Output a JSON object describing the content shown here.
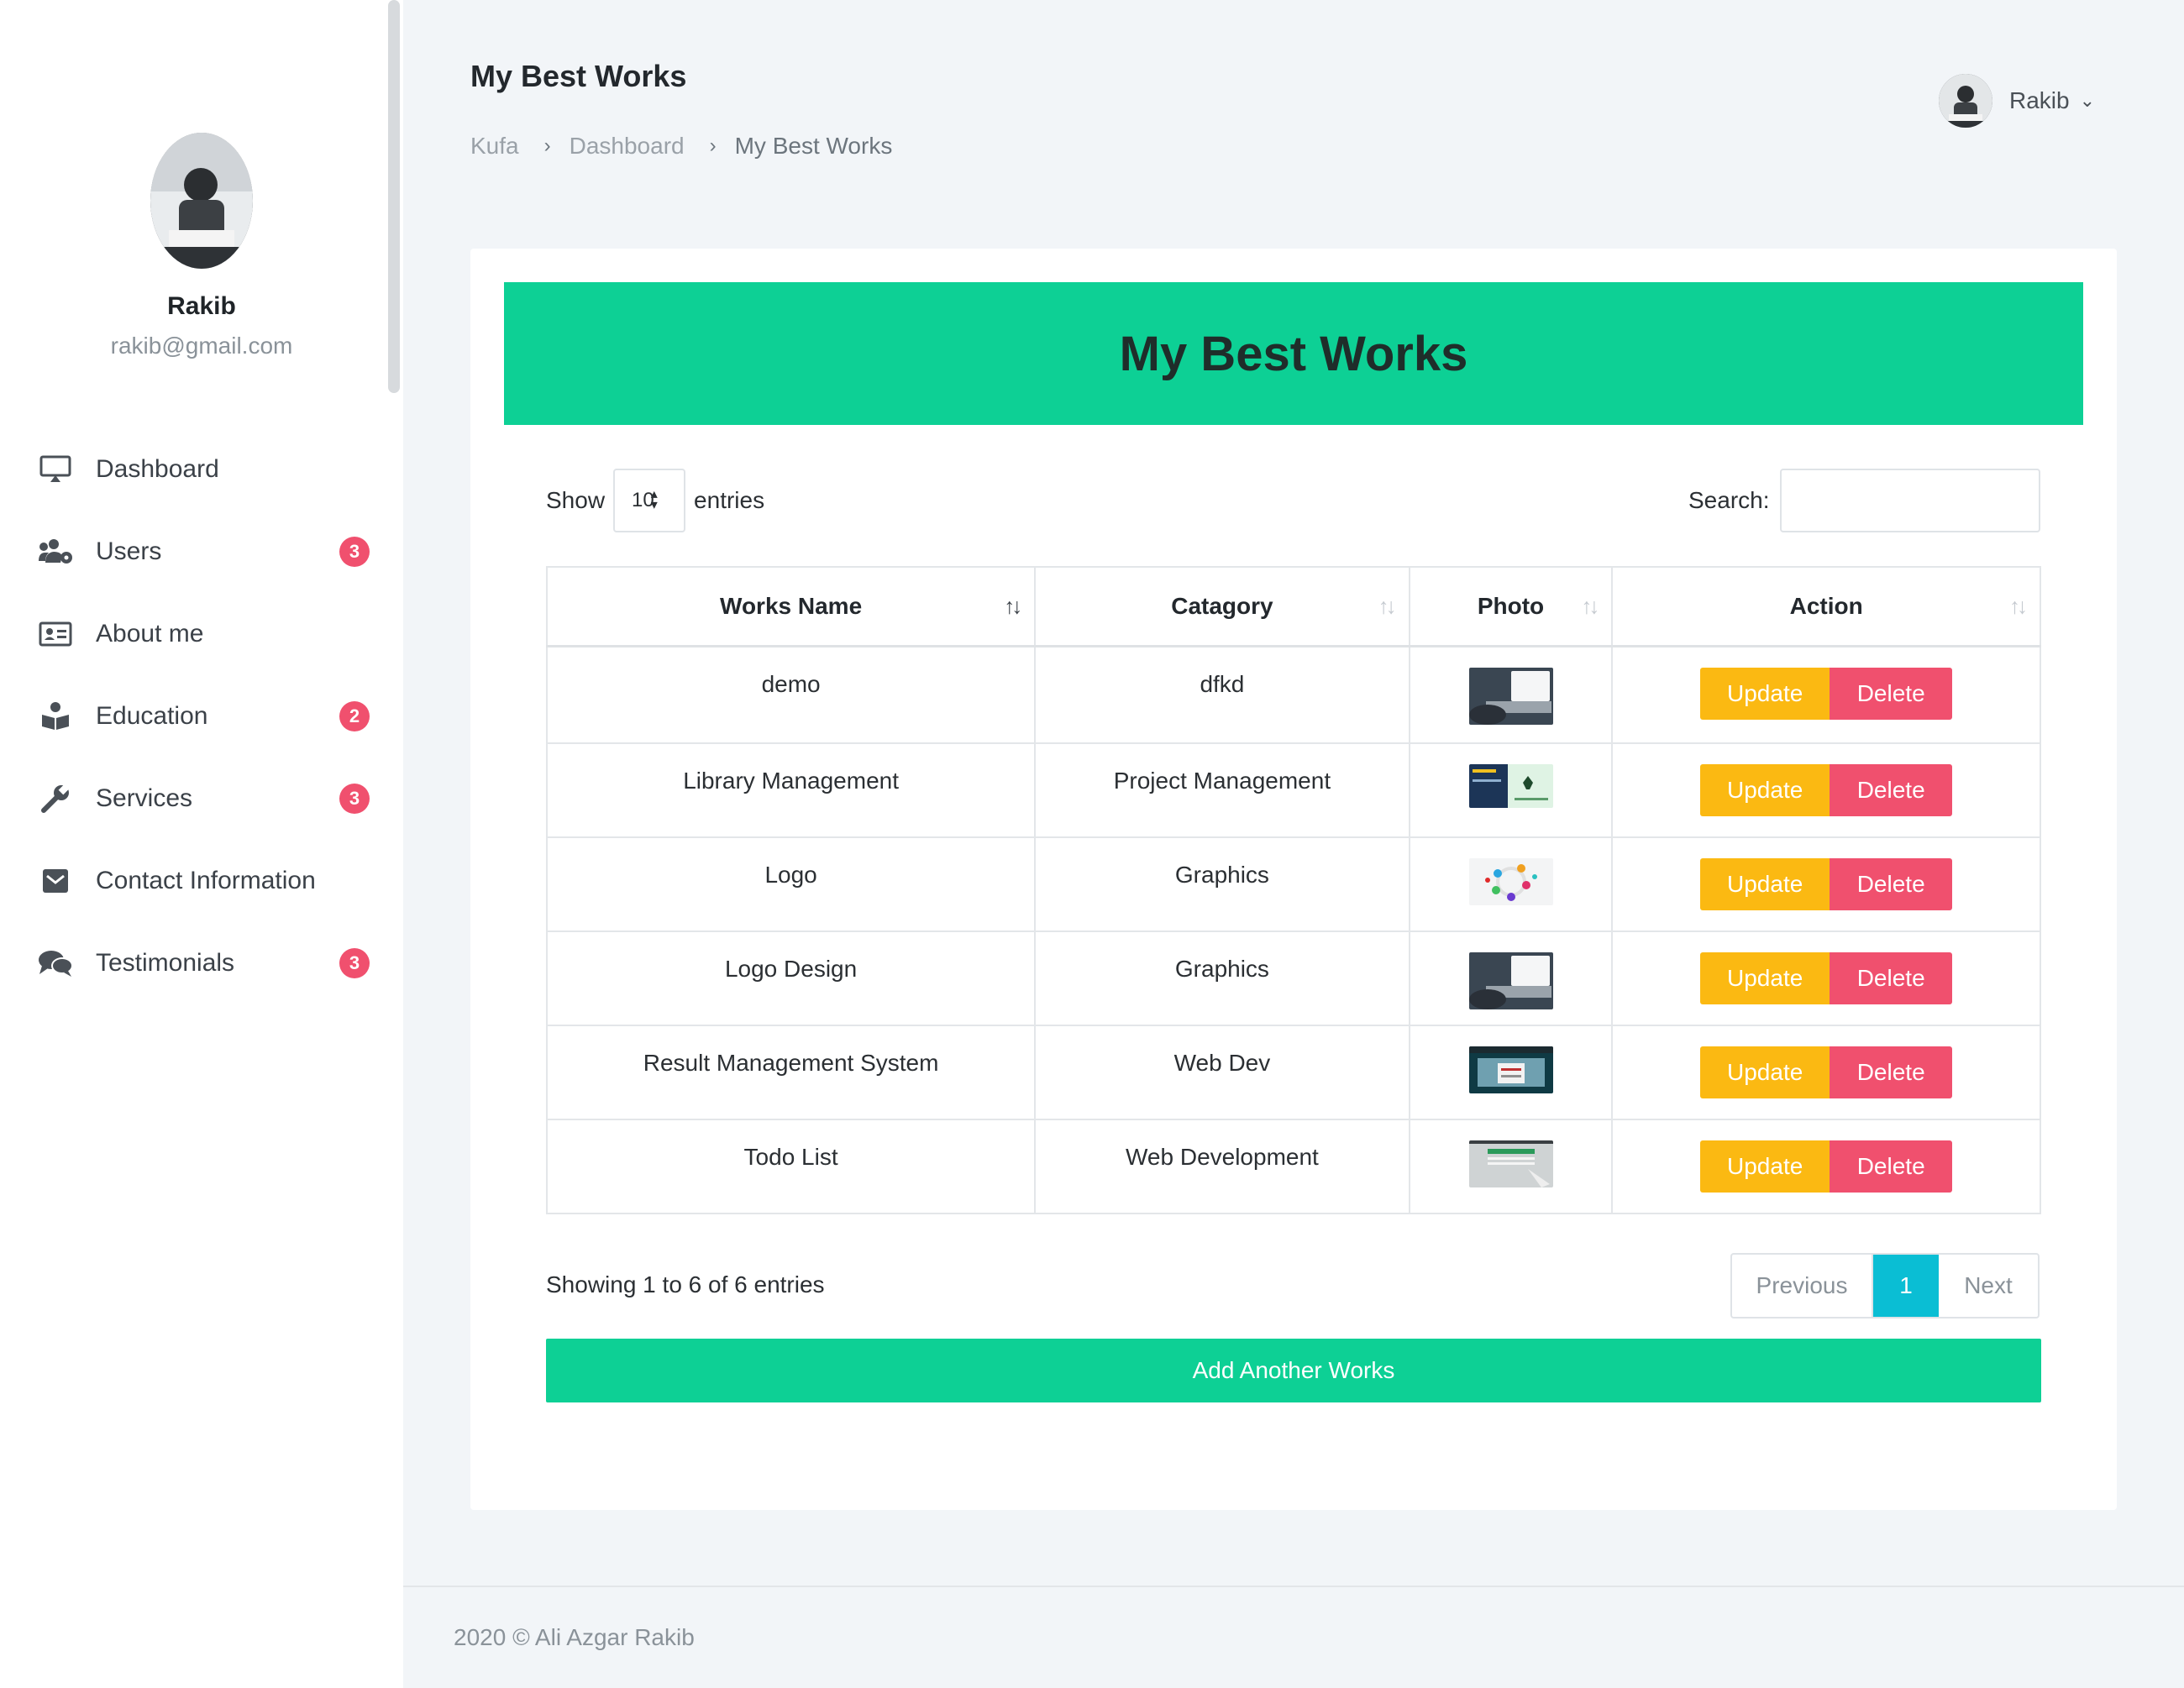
{
  "sidebar": {
    "profile": {
      "name": "Rakib",
      "email": "rakib@gmail.com"
    },
    "items": [
      {
        "label": "Dashboard",
        "icon": "monitor-icon",
        "badge": null
      },
      {
        "label": "Users",
        "icon": "users-gear-icon",
        "badge": "3"
      },
      {
        "label": "About me",
        "icon": "id-card-icon",
        "badge": null
      },
      {
        "label": "Education",
        "icon": "book-reader-icon",
        "badge": "2"
      },
      {
        "label": "Services",
        "icon": "wrench-icon",
        "badge": "3"
      },
      {
        "label": "Contact Information",
        "icon": "envelope-icon",
        "badge": null
      },
      {
        "label": "Testimonials",
        "icon": "comments-icon",
        "badge": "3"
      }
    ]
  },
  "header": {
    "title": "My Best Works",
    "breadcrumb": [
      "Kufa",
      "Dashboard",
      "My Best Works"
    ],
    "user": {
      "name": "Rakib"
    }
  },
  "card": {
    "banner_title": "My Best Works",
    "show_label": "Show",
    "entries_value": "10",
    "entries_label": "entries",
    "search_label": "Search:",
    "search_value": "",
    "columns": [
      "Works Name",
      "Catagory",
      "Photo",
      "Action"
    ],
    "rows": [
      {
        "name": "demo",
        "category": "dfkd",
        "photo": "laptop-photo"
      },
      {
        "name": "Library Management",
        "category": "Project Management",
        "photo": "library-web-photo"
      },
      {
        "name": "Logo",
        "category": "Graphics",
        "photo": "colorful-logo-photo"
      },
      {
        "name": "Logo Design",
        "category": "Graphics",
        "photo": "laptop-photo"
      },
      {
        "name": "Result Management System",
        "category": "Web Dev",
        "photo": "result-web-photo"
      },
      {
        "name": "Todo List",
        "category": "Web Development",
        "photo": "todo-web-photo"
      }
    ],
    "update_label": "Update",
    "delete_label": "Delete",
    "info": "Showing 1 to 6 of 6 entries",
    "pager": {
      "previous": "Previous",
      "current": "1",
      "next": "Next"
    },
    "add_button": "Add Another Works"
  },
  "footer": {
    "text": "2020 © Ali Azgar Rakib"
  },
  "colors": {
    "accent": "#0dd095",
    "update": "#fbb912",
    "delete": "#f0506e",
    "badge": "#f0506e",
    "page_active": "#0abed4"
  }
}
